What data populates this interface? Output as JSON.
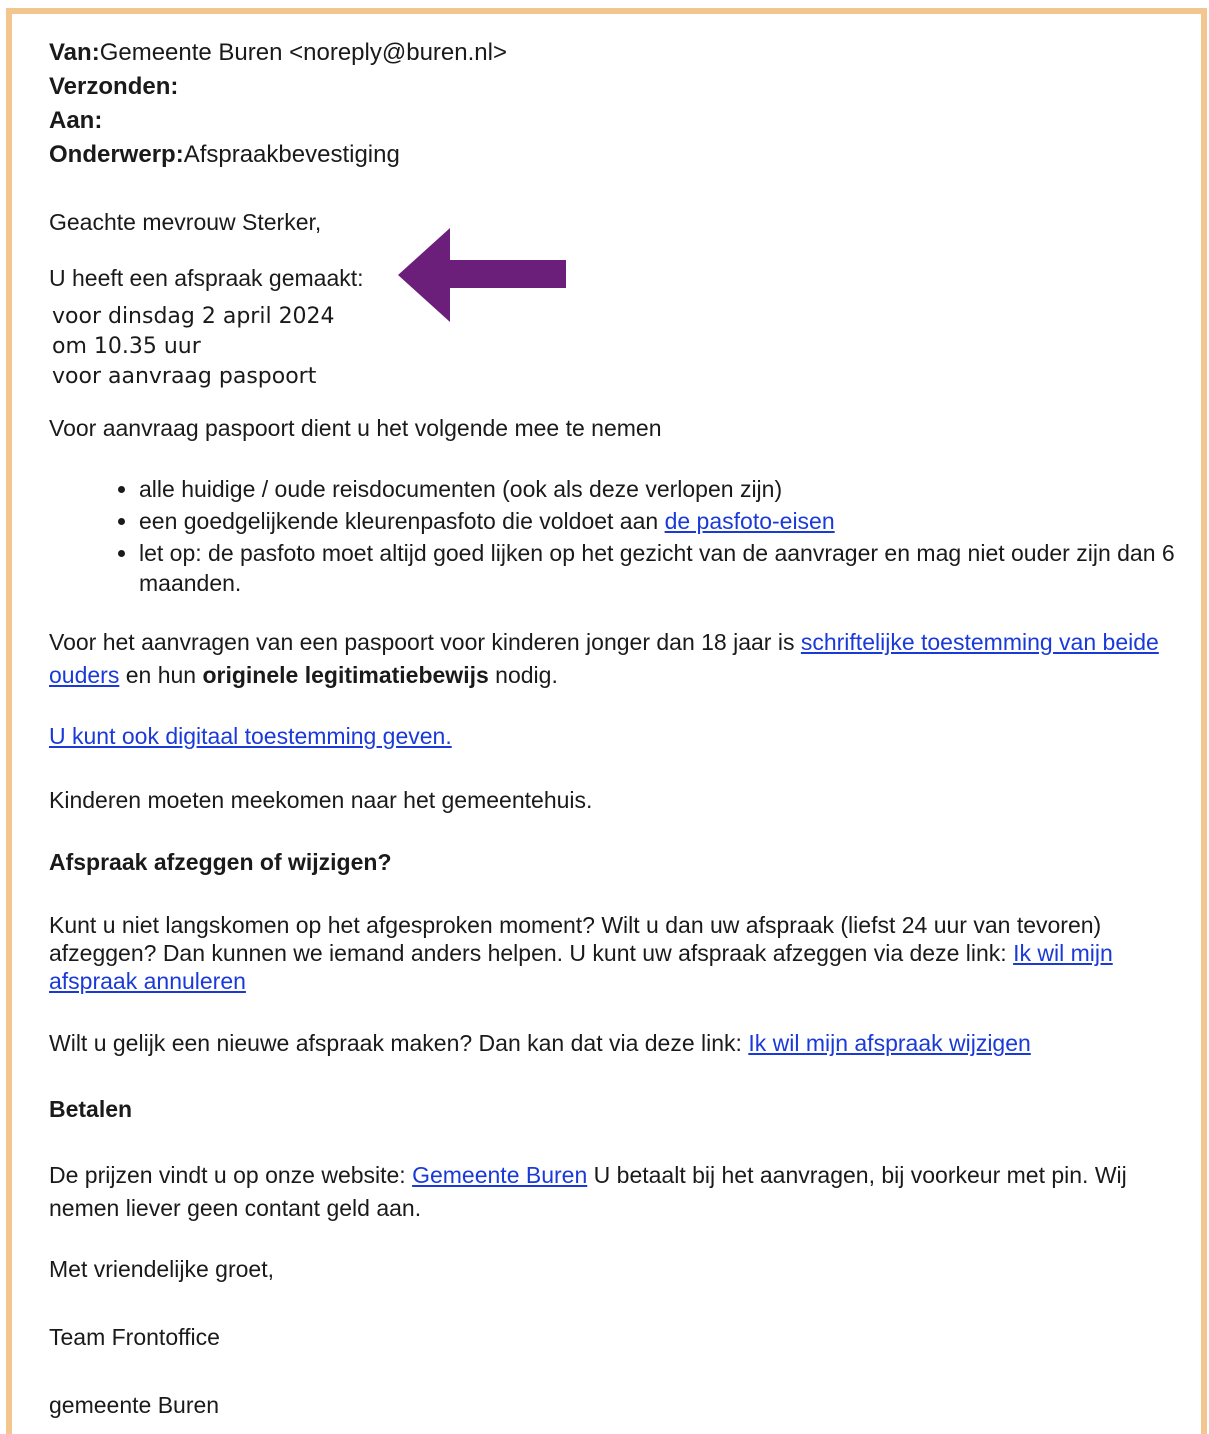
{
  "header": {
    "from_label": "Van:",
    "from_value": "Gemeente Buren <noreply@buren.nl>",
    "sent_label": "Verzonden:",
    "to_label": "Aan:",
    "subject_label": "Onderwerp:",
    "subject_value": "Afspraakbevestiging"
  },
  "body": {
    "greeting": "Geachte mevrouw Sterker,",
    "appointment_made": "U heeft een afspraak gemaakt:",
    "appointment_lines": [
      "voor dinsdag 2 april 2024",
      "om 10.35 uur",
      "voor aanvraag paspoort"
    ],
    "intro": "Voor aanvraag paspoort dient u het volgende mee te nemen",
    "bullets": {
      "b1": "alle huidige / oude reisdocumenten (ook als deze verlopen zijn)",
      "b2_text": "een goedgelijkende kleurenpasfoto die voldoet aan ",
      "b2_link": "de pasfoto-eisen",
      "b3": "let op: de pasfoto moet altijd goed lijken op het gezicht van de aanvrager en mag niet ouder zijn dan 6 maanden."
    },
    "kids": {
      "pre": "Voor het aanvragen van een paspoort voor kinderen jonger dan 18 jaar is ",
      "link": "schriftelijke toestemming van beide ouders",
      "mid": " en hun ",
      "bold": "originele legitimatiebewijs",
      "post": " nodig."
    },
    "digital_link": "U kunt ook digitaal toestemming geven.",
    "kids_come": "Kinderen moeten meekomen naar het gemeentehuis.",
    "cancel_heading": "Afspraak afzeggen of wijzigen?",
    "cancel": {
      "text": "Kunt u niet langskomen op het afgesproken moment? Wilt u dan uw afspraak (liefst 24 uur van tevoren) afzeggen? Dan kunnen we iemand anders helpen. U kunt uw afspraak afzeggen via deze link: ",
      "link": "Ik wil mijn afspraak annuleren"
    },
    "change": {
      "text": "Wilt u gelijk een nieuwe afspraak maken? Dan kan dat via deze link: ",
      "link": "Ik wil mijn afspraak wijzigen"
    },
    "pay_heading": "Betalen",
    "pay": {
      "pre": "De prijzen vindt u op onze website: ",
      "link": "Gemeente Buren",
      "post": " U betaalt bij het aanvragen, bij voorkeur met pin. Wij nemen liever geen contant geld aan."
    },
    "closing": "Met vriendelijke groet,",
    "team": "Team Frontoffice",
    "municipality": "gemeente Buren"
  },
  "colors": {
    "frame": "#f3c58f",
    "arrow": "#6b1f7a",
    "link": "#1a3ad8"
  },
  "icons": {
    "arrow": "left-arrow-icon"
  }
}
